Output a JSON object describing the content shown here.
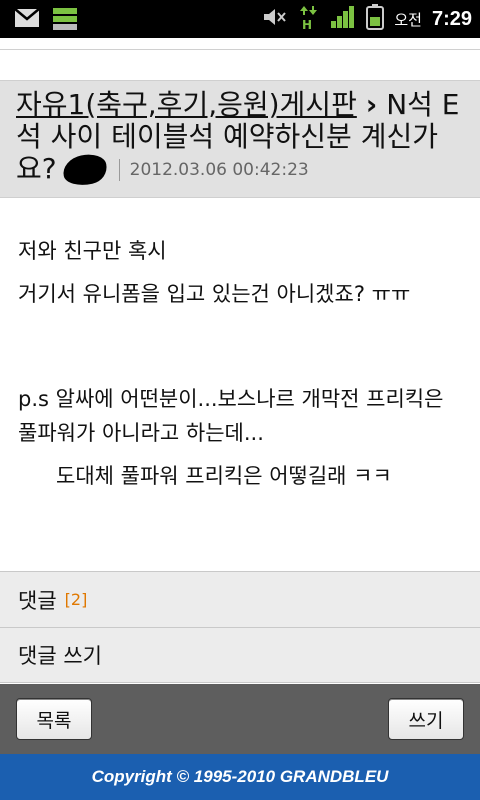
{
  "status_bar": {
    "ampm": "오전",
    "time": "7:29",
    "icons": [
      "gmail-icon",
      "storage-icon",
      "mute-icon",
      "data-transfer-icon",
      "signal-icon",
      "battery-icon"
    ],
    "hspa_label": "H"
  },
  "post": {
    "board_link": "자유1(축구,후기,응원)게시판",
    "breadcrumb_sep": "›",
    "title": "N석 E석 사이 테이블석 예약하신분 계신가요?",
    "date": "2012.03.06 00:42:23",
    "body": {
      "line1": "저와 친구만 혹시",
      "line2": "거기서 유니폼을 입고 있는건 아니겠죠? ㅠㅠ",
      "line3": "p.s 알싸에 어떤분이...보스나르 개막전 프리킥은 풀파워가 아니라고 하는데...",
      "line4": "도대체 풀파워 프리킥은 어떻길래 ㅋㅋ"
    }
  },
  "comments_row": {
    "label": "댓글",
    "count": "[2]"
  },
  "write_comment_row": {
    "label": "댓글 쓰기"
  },
  "buttons": {
    "list": "목록",
    "write": "쓰기"
  },
  "footer": {
    "copyright": "Copyright © 1995-2010 GRANDBLEU"
  },
  "colors": {
    "footer_bg": "#1b5fb0",
    "count_accent": "#e07800",
    "status_bar": "#000000"
  }
}
